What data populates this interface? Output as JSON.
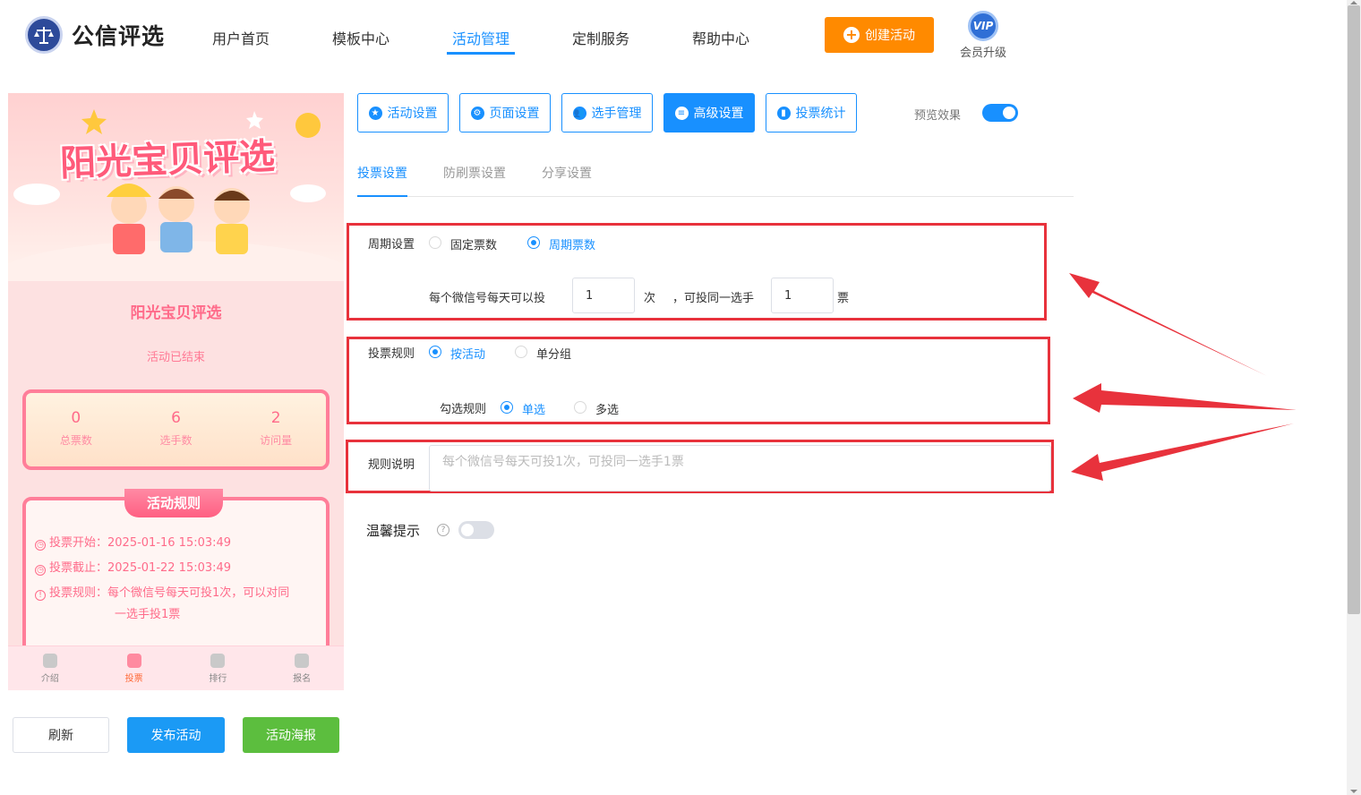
{
  "header": {
    "brand": "公信评选",
    "nav": [
      "用户首页",
      "模板中心",
      "活动管理",
      "定制服务",
      "帮助中心"
    ],
    "create_button": "创建活动",
    "vip_badge": "VIP",
    "vip_label": "会员升级"
  },
  "preview": {
    "banner_title": "阳光宝贝评选",
    "activity_name": "阳光宝贝评选",
    "status": "活动已结束",
    "stats": [
      {
        "value": "0",
        "label": "总票数"
      },
      {
        "value": "6",
        "label": "选手数"
      },
      {
        "value": "2",
        "label": "访问量"
      }
    ],
    "rules_title": "活动规则",
    "rules": [
      "投票开始：2025-01-16 15:03:49",
      "投票截止：2025-01-22 15:03:49",
      "投票规则：每个微信号每天可投1次，可以对同",
      "一选手投1票"
    ],
    "tabbar": [
      "介绍",
      "投票",
      "排行",
      "报名"
    ]
  },
  "actions": {
    "refresh": "刷新",
    "publish": "发布活动",
    "poster": "活动海报"
  },
  "settings_tabs": [
    "活动设置",
    "页面设置",
    "选手管理",
    "高级设置",
    "投票统计"
  ],
  "preview_toggle_label": "预览效果",
  "sub_tabs": [
    "投票设置",
    "防刷票设置",
    "分享设置"
  ],
  "period": {
    "label": "周期设置",
    "options": [
      "固定票数",
      "周期票数"
    ],
    "selected": "周期票数",
    "daily_prefix": "每个微信号每天可以投",
    "daily_value": "1",
    "daily_unit": "次",
    "same_prefix": "，可投同一选手",
    "same_value": "1",
    "same_unit": "票"
  },
  "vote_rule": {
    "label": "投票规则",
    "options": [
      "按活动",
      "单分组"
    ],
    "selected": "按活动",
    "check_label": "勾选规则",
    "check_options": [
      "单选",
      "多选"
    ],
    "check_selected": "单选"
  },
  "rule_desc": {
    "label": "规则说明",
    "placeholder": "每个微信号每天可投1次，可投同一选手1票"
  },
  "tip": {
    "label": "温馨提示",
    "enabled": false
  },
  "colors": {
    "primary": "#1890ff",
    "create": "#ff8a00",
    "publish": "#1b9af5",
    "poster": "#5cbe3e",
    "highlight": "#e8323c"
  }
}
